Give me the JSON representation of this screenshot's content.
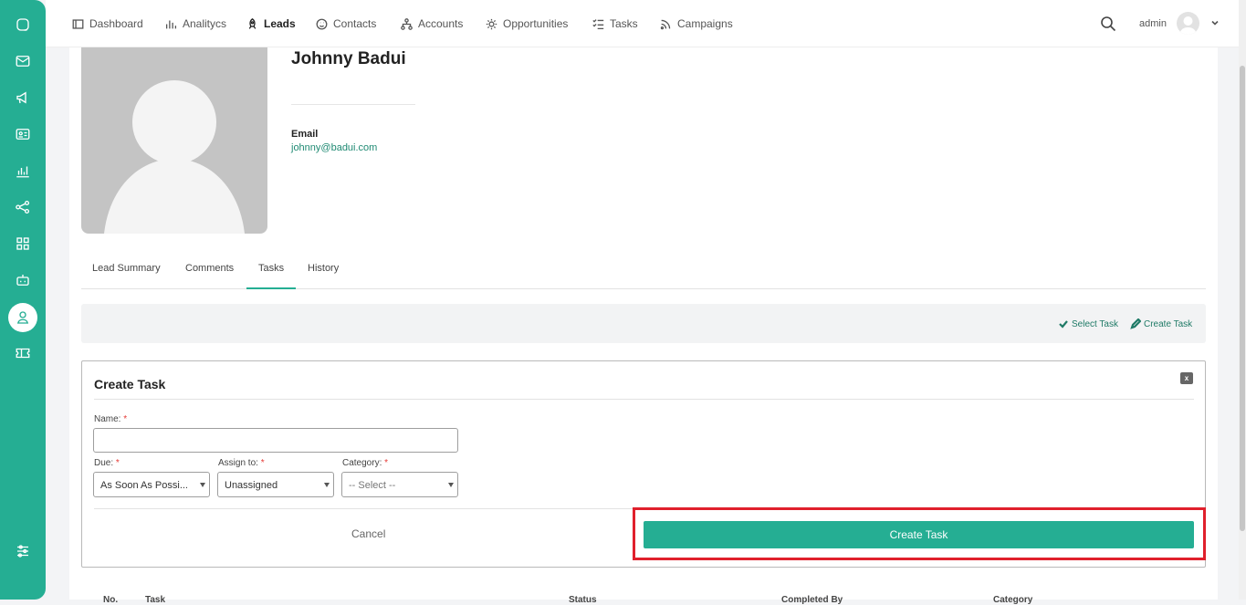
{
  "nav": {
    "items": [
      {
        "label": "Dashboard",
        "icon": "dashboard-icon"
      },
      {
        "label": "Analitycs",
        "icon": "bar-chart-icon"
      },
      {
        "label": "Leads",
        "icon": "rocket-icon"
      },
      {
        "label": "Contacts",
        "icon": "smiley-icon"
      },
      {
        "label": "Accounts",
        "icon": "hierarchy-icon"
      },
      {
        "label": "Opportunities",
        "icon": "sun-icon"
      },
      {
        "label": "Tasks",
        "icon": "checklist-icon"
      },
      {
        "label": "Campaigns",
        "icon": "rss-icon"
      }
    ],
    "active": "Leads",
    "user": "admin"
  },
  "sidebar": {
    "icons": [
      "chat-icon",
      "mail-icon",
      "megaphone-icon",
      "contact-card-icon",
      "analytics-icon",
      "share-icon",
      "grid-icon",
      "robot-icon",
      "user-icon",
      "ticket-icon",
      "settings-sliders-icon"
    ],
    "active": "user-icon"
  },
  "lead": {
    "name": "Johnny Badui",
    "email_label": "Email",
    "email": "johnny@badui.com"
  },
  "tabs": {
    "items": [
      "Lead Summary",
      "Comments",
      "Tasks",
      "History"
    ],
    "active": "Tasks"
  },
  "actions": {
    "select_task": "Select Task",
    "create_task": "Create Task"
  },
  "form": {
    "title": "Create Task",
    "close": "x",
    "name_label": "Name:",
    "name_value": "",
    "due_label": "Due:",
    "due_value": "As Soon As Possi...",
    "assign_label": "Assign to:",
    "assign_value": "Unassigned",
    "category_label": "Category:",
    "category_value": "-- Select --",
    "required_mark": "*",
    "cancel": "Cancel",
    "submit": "Create Task"
  },
  "table": {
    "headers": [
      "No.",
      "Task",
      "Status",
      "Completed By",
      "Category"
    ]
  },
  "colors": {
    "accent": "#25ae93",
    "highlight": "#e0202c"
  }
}
